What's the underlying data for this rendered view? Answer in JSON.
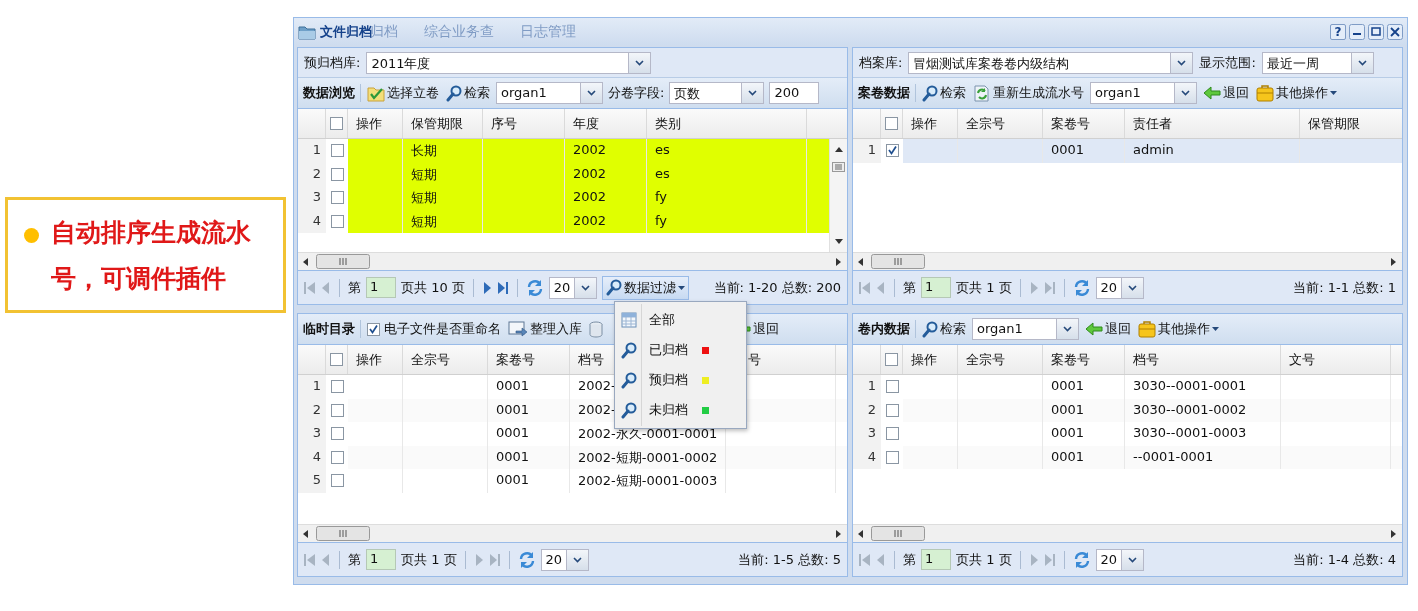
{
  "callout": {
    "text": "自动排序生成流水号，可调件插件"
  },
  "window": {
    "title": "文件归档",
    "background_tabs": [
      "归档",
      "综合业务查",
      "日志管理"
    ],
    "help_button": "?"
  },
  "panels": [
    {
      "combos": [
        {
          "label": "预归档库:",
          "value": "2011年度"
        }
      ],
      "toolbar": [
        {
          "kind": "title",
          "text": "数据浏览"
        },
        {
          "kind": "button",
          "text": "选择立卷"
        },
        {
          "kind": "button",
          "text": "检索"
        },
        {
          "kind": "combo",
          "value": "organ1"
        },
        {
          "kind": "label",
          "text": "分卷字段:"
        },
        {
          "kind": "combo",
          "value": "页数"
        },
        {
          "kind": "field",
          "value": "200"
        }
      ],
      "select_all_checked": false,
      "columns": [
        "操作",
        "保管期限",
        "序号",
        "年度",
        "类别"
      ],
      "rows": [
        {
          "number": "1",
          "checked": false,
          "selected": false,
          "color": "#e0ff00",
          "cells": [
            "",
            "长期",
            "",
            "2002",
            "es"
          ]
        },
        {
          "number": "2",
          "checked": false,
          "selected": false,
          "color": "#e0ff00",
          "cells": [
            "",
            "短期",
            "",
            "2002",
            "es"
          ]
        },
        {
          "number": "3",
          "checked": false,
          "selected": false,
          "color": "#e0ff00",
          "cells": [
            "",
            "短期",
            "",
            "2002",
            "fy"
          ]
        },
        {
          "number": "4",
          "checked": false,
          "selected": false,
          "color": "#e0ff00",
          "cells": [
            "",
            "短期",
            "",
            "2002",
            "fy"
          ]
        }
      ],
      "pager": {
        "before": "第",
        "page": "1",
        "after": "页共 10 页",
        "next_enabled": true,
        "page_size": "20",
        "filter": {
          "text": "数据过滤",
          "expanded": true
        },
        "status": "当前: 1-20 总数: 200"
      }
    },
    {
      "combos": [
        {
          "label": "档案库:",
          "value": "冒烟测试库案卷卷内级结构"
        },
        {
          "label": "显示范围:",
          "value": "最近一周"
        }
      ],
      "toolbar": [
        {
          "kind": "title",
          "text": "案卷数据"
        },
        {
          "kind": "button",
          "text": "检索"
        },
        {
          "kind": "button",
          "text": "重新生成流水号"
        },
        {
          "kind": "combo",
          "value": "organ1"
        },
        {
          "kind": "button",
          "text": "退回"
        },
        {
          "kind": "menu",
          "text": "其他操作"
        }
      ],
      "select_all_checked": false,
      "columns": [
        "操作",
        "全宗号",
        "案卷号",
        "责任者",
        "保管期限"
      ],
      "rows": [
        {
          "number": "1",
          "checked": true,
          "selected": true,
          "cells": [
            "",
            "",
            "0001",
            "admin",
            ""
          ]
        }
      ],
      "pager": {
        "before": "第",
        "page": "1",
        "after": "页共 1 页",
        "next_enabled": false,
        "page_size": "20",
        "status": "当前: 1-1 总数: 1"
      }
    },
    {
      "toolbar": [
        {
          "kind": "title",
          "text": "临时目录"
        },
        {
          "kind": "checkbox",
          "checked": true,
          "text": "电子文件是否重命名"
        },
        {
          "kind": "button",
          "text": "整理入库"
        },
        {
          "kind": "icon"
        },
        {
          "kind": "button",
          "text": "退回"
        }
      ],
      "select_all_checked": false,
      "columns": [
        "操作",
        "全宗号",
        "案卷号",
        "档号",
        "号"
      ],
      "rows": [
        {
          "number": "1",
          "checked": false,
          "selected": false,
          "cells": [
            "",
            "",
            "0001",
            "2002-",
            ""
          ]
        },
        {
          "number": "2",
          "checked": false,
          "selected": false,
          "cells": [
            "",
            "",
            "0001",
            "2002-",
            ""
          ]
        },
        {
          "number": "3",
          "checked": false,
          "selected": false,
          "cells": [
            "",
            "",
            "0001",
            "2002-永久-0001-0001",
            ""
          ]
        },
        {
          "number": "4",
          "checked": false,
          "selected": false,
          "cells": [
            "",
            "",
            "0001",
            "2002-短期-0001-0002",
            ""
          ]
        },
        {
          "number": "5",
          "checked": false,
          "selected": false,
          "cells": [
            "",
            "",
            "0001",
            "2002-短期-0001-0003",
            ""
          ]
        }
      ],
      "pager": {
        "before": "第",
        "page": "1",
        "after": "页共 1 页",
        "next_enabled": false,
        "page_size": "20",
        "status": "当前: 1-5 总数: 5"
      }
    },
    {
      "toolbar": [
        {
          "kind": "title",
          "text": "卷内数据"
        },
        {
          "kind": "button",
          "text": "检索"
        },
        {
          "kind": "combo",
          "value": "organ1"
        },
        {
          "kind": "button",
          "text": "退回"
        },
        {
          "kind": "menu",
          "text": "其他操作"
        }
      ],
      "select_all_checked": false,
      "columns": [
        "操作",
        "全宗号",
        "案卷号",
        "档号",
        "文号"
      ],
      "rows": [
        {
          "number": "1",
          "checked": false,
          "selected": false,
          "cells": [
            "",
            "",
            "0001",
            "3030--0001-0001",
            ""
          ]
        },
        {
          "number": "2",
          "checked": false,
          "selected": false,
          "cells": [
            "",
            "",
            "0001",
            "3030--0001-0002",
            ""
          ]
        },
        {
          "number": "3",
          "checked": false,
          "selected": false,
          "cells": [
            "",
            "",
            "0001",
            "3030--0001-0003",
            ""
          ]
        },
        {
          "number": "4",
          "checked": false,
          "selected": false,
          "cells": [
            "",
            "",
            "0001",
            "--0001-0001",
            ""
          ]
        }
      ],
      "pager": {
        "before": "第",
        "page": "1",
        "after": "页共 1 页",
        "next_enabled": false,
        "page_size": "20",
        "status": "当前: 1-4 总数: 4"
      }
    }
  ],
  "filter_menu": {
    "items": [
      {
        "label": "全部"
      },
      {
        "label": "已归档",
        "color": "#ee1111"
      },
      {
        "label": "预归档",
        "color": "#eeee22"
      },
      {
        "label": "未归档",
        "color": "#22cc44"
      }
    ]
  }
}
